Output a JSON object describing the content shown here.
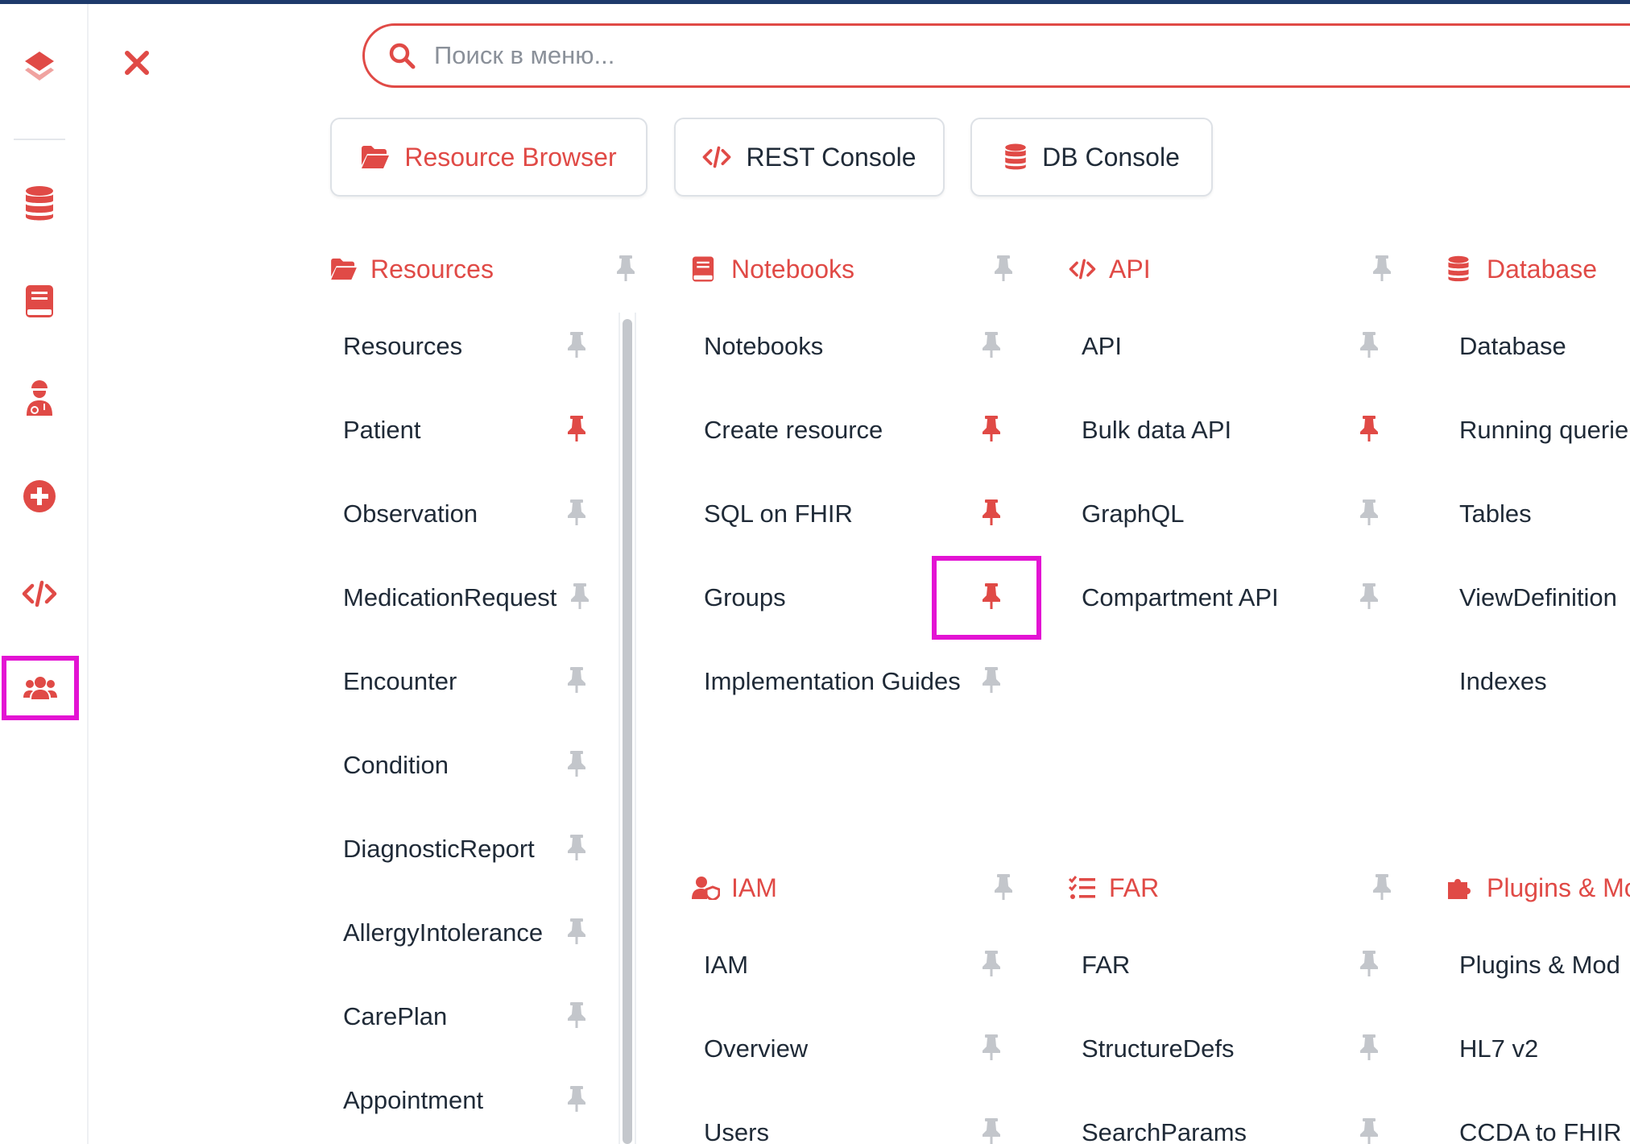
{
  "search": {
    "placeholder": "Поиск в меню..."
  },
  "quick_buttons": [
    {
      "label": "Resource Browser",
      "icon": "folder-open-icon",
      "active": true
    },
    {
      "label": "REST Console",
      "icon": "code-icon",
      "active": false
    },
    {
      "label": "DB Console",
      "icon": "database-icon",
      "active": false
    }
  ],
  "rail": {
    "items": [
      "layers-icon",
      "database-icon",
      "book-icon",
      "user-doctor-icon",
      "plus-circle-icon",
      "code-icon",
      "users-icon"
    ],
    "selected": "users-icon"
  },
  "colors": {
    "accent": "#e04a46",
    "pin_inactive": "#c3c6cb",
    "highlight": "#e313d3",
    "text": "#1f2a37"
  },
  "sections": {
    "resources": {
      "title": "Resources",
      "icon": "folder-open-icon",
      "items": [
        {
          "label": "Resources",
          "pinned": false
        },
        {
          "label": "Patient",
          "pinned": true
        },
        {
          "label": "Observation",
          "pinned": false
        },
        {
          "label": "MedicationRequest",
          "pinned": false
        },
        {
          "label": "Encounter",
          "pinned": false
        },
        {
          "label": "Condition",
          "pinned": false
        },
        {
          "label": "DiagnosticReport",
          "pinned": false
        },
        {
          "label": "AllergyIntolerance",
          "pinned": false
        },
        {
          "label": "CarePlan",
          "pinned": false
        },
        {
          "label": "Appointment",
          "pinned": false
        }
      ]
    },
    "notebooks": {
      "title": "Notebooks",
      "icon": "book-icon",
      "items": [
        {
          "label": "Notebooks",
          "pinned": false
        },
        {
          "label": "Create resource",
          "pinned": true
        },
        {
          "label": "SQL on FHIR",
          "pinned": true
        },
        {
          "label": "Groups",
          "pinned": true
        },
        {
          "label": "Implementation Guides",
          "pinned": false
        }
      ]
    },
    "api": {
      "title": "API",
      "icon": "code-icon",
      "items": [
        {
          "label": "API",
          "pinned": false
        },
        {
          "label": "Bulk data API",
          "pinned": true
        },
        {
          "label": "GraphQL",
          "pinned": false
        },
        {
          "label": "Compartment API",
          "pinned": false
        }
      ]
    },
    "database": {
      "title": "Database",
      "icon": "database-icon",
      "items": [
        {
          "label": "Database"
        },
        {
          "label": "Running querie"
        },
        {
          "label": "Tables"
        },
        {
          "label": "ViewDefinition"
        },
        {
          "label": "Indexes"
        }
      ]
    },
    "iam": {
      "title": "IAM",
      "icon": "user-shield-icon",
      "items": [
        {
          "label": "IAM",
          "pinned": false
        },
        {
          "label": "Overview",
          "pinned": false
        },
        {
          "label": "Users",
          "pinned": false
        }
      ]
    },
    "far": {
      "title": "FAR",
      "icon": "list-check-icon",
      "items": [
        {
          "label": "FAR",
          "pinned": false
        },
        {
          "label": "StructureDefs",
          "pinned": false
        },
        {
          "label": "SearchParams",
          "pinned": false
        }
      ]
    },
    "plugins": {
      "title": "Plugins & Mo",
      "icon": "puzzle-icon",
      "items": [
        {
          "label": "Plugins & Mod"
        },
        {
          "label": "HL7 v2"
        },
        {
          "label": "CCDA to FHIR"
        }
      ]
    }
  }
}
